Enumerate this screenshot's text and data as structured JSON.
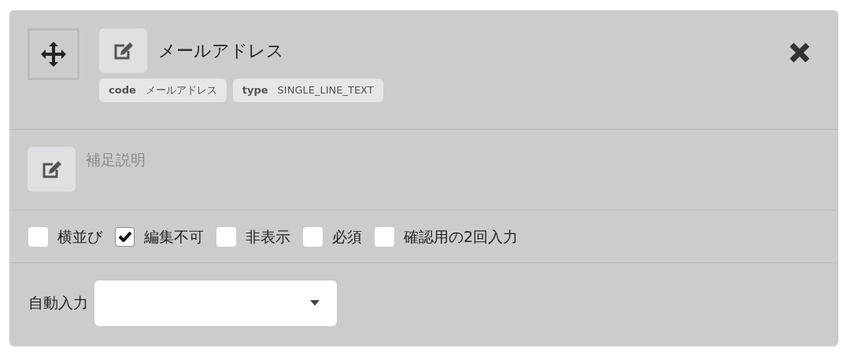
{
  "field": {
    "label": "メールアドレス",
    "tags": [
      {
        "key": "code",
        "value": "メールアドレス"
      },
      {
        "key": "type",
        "value": "SINGLE_LINE_TEXT"
      }
    ]
  },
  "description": {
    "placeholder": "補足説明"
  },
  "options": [
    {
      "label": "横並び",
      "checked": false
    },
    {
      "label": "編集不可",
      "checked": true
    },
    {
      "label": "非表示",
      "checked": false
    },
    {
      "label": "必須",
      "checked": false
    },
    {
      "label": "確認用の2回入力",
      "checked": false
    }
  ],
  "autofill": {
    "label": "自動入力"
  }
}
